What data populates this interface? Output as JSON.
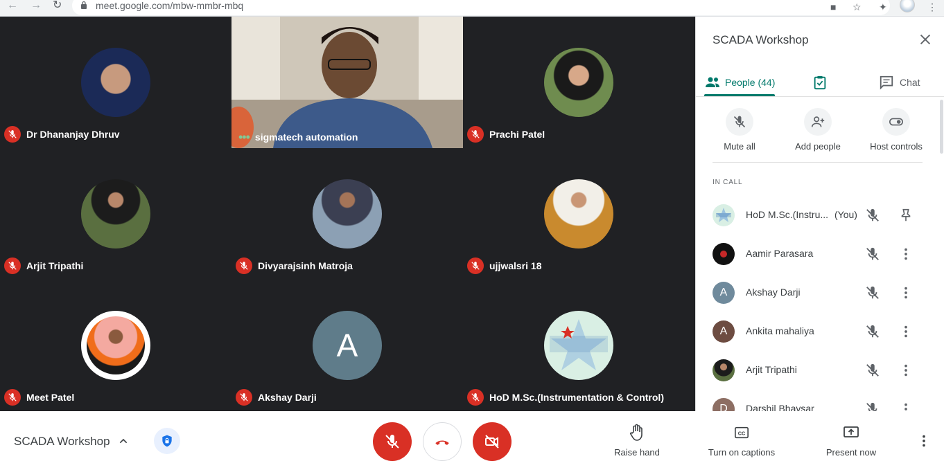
{
  "browser": {
    "url": "meet.google.com/mbw-mmbr-mbq"
  },
  "tiles": [
    {
      "name": "Dr Dhananjay Dhruv",
      "muted": true,
      "kind": "photo",
      "color": "#1b2a57"
    },
    {
      "name": "sigmatech automation",
      "muted": false,
      "kind": "video"
    },
    {
      "name": "Prachi Patel",
      "muted": true,
      "kind": "photo",
      "color": "#4f6b3a"
    },
    {
      "name": "Arjit Tripathi",
      "muted": true,
      "kind": "photo",
      "color": "#5a6f40"
    },
    {
      "name": "Divyarajsinh Matroja",
      "muted": true,
      "kind": "photo",
      "color": "#8ca0b4"
    },
    {
      "name": "ujjwalsri 18",
      "muted": true,
      "kind": "photo",
      "color": "#c98a2e"
    },
    {
      "name": "Meet Patel",
      "muted": true,
      "kind": "photo",
      "color": "#f06d1a"
    },
    {
      "name": "Akshay Darji",
      "muted": true,
      "kind": "letter",
      "letter": "A",
      "color": "#5f7c8a"
    },
    {
      "name": "HoD M.Sc.(Instrumentation & Control)",
      "muted": true,
      "kind": "logo"
    }
  ],
  "panel": {
    "title": "SCADA Workshop",
    "tabs": {
      "people": "People (44)",
      "chat": "Chat"
    },
    "actions": {
      "mute_all": "Mute all",
      "add_people": "Add people",
      "host_controls": "Host controls"
    },
    "section_label": "IN CALL",
    "people": [
      {
        "name": "HoD M.Sc.(Instru...",
        "you": "(You)",
        "avatar": "logo",
        "trailing": "pin"
      },
      {
        "name": "Aamir Parasara",
        "avatar": "dark",
        "color": "#111111",
        "trailing": "more"
      },
      {
        "name": "Akshay Darji",
        "avatar": "letter",
        "letter": "A",
        "color": "#6f8a9c",
        "trailing": "more"
      },
      {
        "name": "Ankita mahaliya",
        "avatar": "letter",
        "letter": "A",
        "color": "#6d4c41",
        "trailing": "more"
      },
      {
        "name": "Arjit Tripathi",
        "avatar": "photo",
        "color": "#4f6b3a",
        "trailing": "more"
      },
      {
        "name": "Darshil Bhavsar",
        "avatar": "letter",
        "letter": "D",
        "color": "#8d6e63",
        "trailing": "more"
      }
    ]
  },
  "bottom": {
    "meeting_title": "SCADA Workshop",
    "raise_hand": "Raise hand",
    "captions": "Turn on captions",
    "present": "Present now"
  },
  "colors": {
    "accent": "#00796b",
    "danger": "#d93025",
    "stage_bg": "#202124"
  }
}
